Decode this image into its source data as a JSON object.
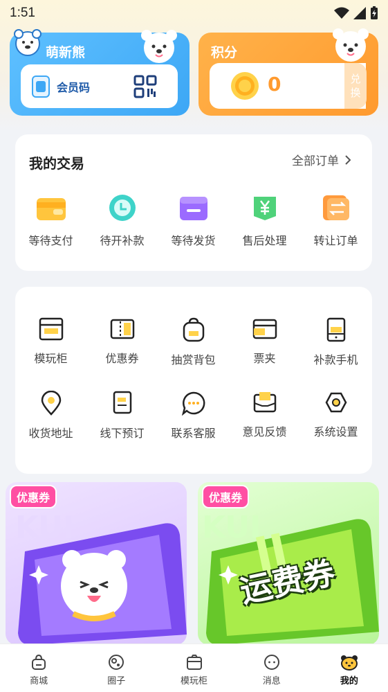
{
  "status": {
    "time": "1:51"
  },
  "member_card": {
    "title": "萌新熊",
    "code_label": "会员码"
  },
  "points_card": {
    "title": "积分",
    "value": "0",
    "exchange_label": "兑换",
    "exchange_chars": [
      "兑",
      "换"
    ]
  },
  "trade": {
    "title": "我的交易",
    "all_orders_label": "全部订单",
    "items": [
      {
        "label": "等待支付",
        "icon": "wallet-icon",
        "color": "#ffc53d"
      },
      {
        "label": "待开补款",
        "icon": "clock-icon",
        "color": "#3ed3c9"
      },
      {
        "label": "等待发货",
        "icon": "box-icon",
        "color": "#9b6bff"
      },
      {
        "label": "售后处理",
        "icon": "yen-icon",
        "color": "#4fd27a"
      },
      {
        "label": "转让订单",
        "icon": "transfer-icon",
        "color": "#ff9a3c"
      }
    ]
  },
  "tools": {
    "row1": [
      {
        "label": "模玩柜",
        "icon": "cabinet-icon"
      },
      {
        "label": "优惠券",
        "icon": "coupon-icon"
      },
      {
        "label": "抽赏背包",
        "icon": "backpack-icon"
      },
      {
        "label": "票夹",
        "icon": "ticket-holder-icon"
      },
      {
        "label": "补款手机",
        "icon": "phone-icon"
      }
    ],
    "row2": [
      {
        "label": "收货地址",
        "icon": "location-icon"
      },
      {
        "label": "线下预订",
        "icon": "receipt-icon"
      },
      {
        "label": "联系客服",
        "icon": "chat-icon"
      },
      {
        "label": "意见反馈",
        "icon": "feedback-icon"
      },
      {
        "label": "系统设置",
        "icon": "settings-icon"
      }
    ]
  },
  "promos": [
    {
      "tag": "优惠券"
    },
    {
      "tag": "优惠券",
      "ticket_text": "运费券"
    }
  ],
  "nav": [
    {
      "label": "商城",
      "icon": "shop-icon"
    },
    {
      "label": "圈子",
      "icon": "circle-icon"
    },
    {
      "label": "模玩柜",
      "icon": "cabinet-icon"
    },
    {
      "label": "消息",
      "icon": "message-icon"
    },
    {
      "label": "我的",
      "icon": "bear-icon",
      "active": true
    }
  ]
}
